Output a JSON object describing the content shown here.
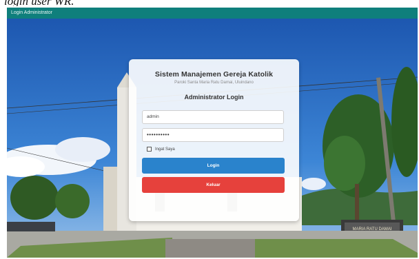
{
  "caption": "login user WR.",
  "window": {
    "title": "Login Administrator"
  },
  "login_card": {
    "system_title": "Sistem Manajemen Gereja Katolik",
    "parish_subtitle": "Paroki Santa Maria Ratu Damai, Uluindano",
    "form_title": "Administrator Login",
    "username_value": "admin",
    "password_value": "••••••••••",
    "remember_label": "Ingat Saya",
    "login_label": "Login",
    "exit_label": "Keluar"
  },
  "background": {
    "sign_text": "MARIA RATU DAMAI",
    "colors": {
      "sky": "#2b6cc4",
      "header": "#0f7f7c",
      "login_button": "#2a83cc",
      "exit_button": "#e6413c"
    }
  }
}
